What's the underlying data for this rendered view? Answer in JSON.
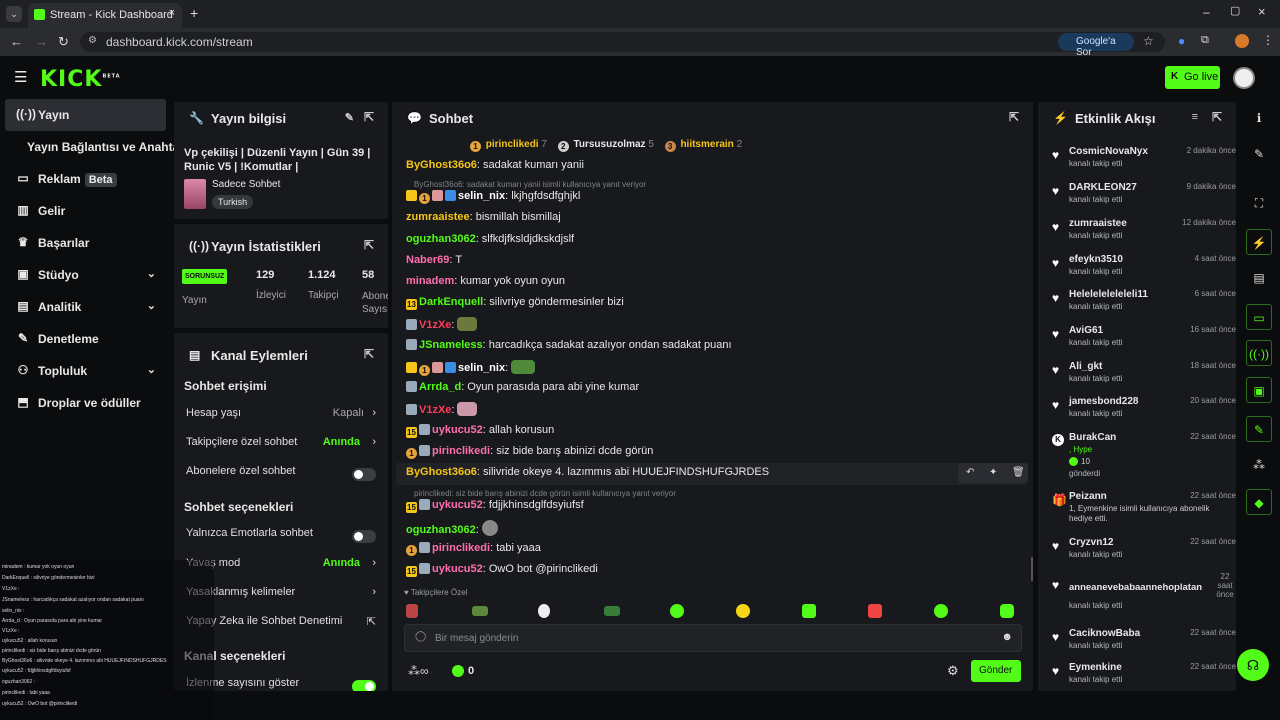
{
  "browser": {
    "tab_title": "Stream - Kick Dashboard",
    "url": "dashboard.kick.com/stream",
    "translate_label": "Google'a Sor"
  },
  "header": {
    "logo": "KICK",
    "logo_sup": "BETA",
    "go_live": "Go live"
  },
  "sidebar": {
    "items": [
      {
        "label": "Yayın",
        "icon": "broadcast-icon"
      },
      {
        "label": "Yayın Bağlantısı ve Anahtarı",
        "icon": ""
      },
      {
        "label": "Reklam",
        "icon": "ad-icon",
        "badge": "Beta"
      },
      {
        "label": "Gelir",
        "icon": "revenue-icon"
      },
      {
        "label": "Başarılar",
        "icon": "trophy-icon"
      },
      {
        "label": "Stüdyo",
        "icon": "studio-icon"
      },
      {
        "label": "Analitik",
        "icon": "chart-icon"
      },
      {
        "label": "Denetleme",
        "icon": "wrench-icon"
      },
      {
        "label": "Topluluk",
        "icon": "community-icon"
      },
      {
        "label": "Droplar ve ödüller",
        "icon": "drops-icon"
      }
    ]
  },
  "stream_info": {
    "title": "Yayın bilgisi",
    "stream_title": "Vp çekilişi | Düzenli Yayın | Gün 39 | Runic V5 | !Komutlar |",
    "category": "Sadece Sohbet",
    "language": "Turkish"
  },
  "stats": {
    "title": "Yayın İstatistikleri",
    "status": "SORUNSUZ",
    "status_label": "Yayın",
    "viewers": "129",
    "viewers_label": "İzleyici",
    "followers": "1.124",
    "followers_label": "Takipçi",
    "subs": "58",
    "subs_label": "Abone Sayısı"
  },
  "actions": {
    "title": "Kanal Eylemleri",
    "chat_access": "Sohbet erişimi",
    "account_age": "Hesap yaşı",
    "account_age_value": "Kapalı",
    "followers_only": "Takipçilere özel sohbet",
    "followers_only_value": "Anında",
    "subs_only": "Abonelere özel sohbet",
    "chat_options": "Sohbet seçenekleri",
    "emote_only": "Yalnızca Emotlarla sohbet",
    "slow_mode": "Yavaş mod",
    "slow_mode_value": "Anında",
    "banned_words": "Yasaklanmış kelimeler",
    "ai_moderation": "Yapay Zeka ile Sohbet Denetimi",
    "channel_options": "Kanal seçenekleri",
    "show_viewers": "İzlenme sayısını göster"
  },
  "chat": {
    "title": "Sohbet",
    "top": [
      {
        "rank": "1",
        "name": "pirinclikedi",
        "count": "7"
      },
      {
        "rank": "2",
        "name": "Tursusuzolmaz",
        "count": "5"
      },
      {
        "rank": "3",
        "name": "hiitsmerain",
        "count": "2"
      }
    ],
    "messages": [
      {
        "user": "ByGhost36o6",
        "text": ": sadakat kumarı yanii",
        "color": "#f5c518"
      },
      {
        "reply": "ByGhost36o6: sadakat kumarı yanii isimli kullanıcıya yanıt veriyor"
      },
      {
        "user": "selin_nix",
        "text": ": lkjhgfdsdfghjkl",
        "color": "#ffffff",
        "badges": true
      },
      {
        "user": "zumraaistee",
        "text": ": bismillah bismillaj",
        "color": "#f5c518"
      },
      {
        "user": "oguzhan3062",
        "text": ": slfkdjfksldjdkskdjslf",
        "color": "#53fc18"
      },
      {
        "user": "Naber69",
        "text": ": T",
        "color": "#ff6fb0"
      },
      {
        "user": "minadem",
        "text": ": kumar yok oyun oyun",
        "color": "#ff6fb0"
      },
      {
        "user": "DarkEnquell",
        "text": ": silivriye göndermesinler bizi",
        "color": "#53fc18"
      },
      {
        "user": "V1zXe",
        "text": ":",
        "color": "#ff3b5c"
      },
      {
        "user": "JSnameless",
        "text": ": harcadıkça sadakat azalıyor ondan sadakat puanı",
        "color": "#53fc18"
      },
      {
        "user": "selin_nix",
        "text": ":",
        "color": "#ffffff"
      },
      {
        "user": "Arrda_d",
        "text": ": Oyun parasıda para abi yine kumar",
        "color": "#53fc18"
      },
      {
        "user": "V1zXe",
        "text": ":",
        "color": "#ff3b5c"
      },
      {
        "user": "uykucu52",
        "text": ": allah korusun",
        "color": "#ff6fb0"
      },
      {
        "user": "pirinclikedi",
        "text": ": siz bide barış abinizi dcde görün",
        "color": "#ff6fb0"
      },
      {
        "user": "ByGhost36o6",
        "text": ": silivride okeye 4. lazımmıs abi HUUEJFINDSHUFGJRDES",
        "color": "#f5c518"
      },
      {
        "reply": "pirinclikedi: siz bide barış abinizi dcde görün isimli kullanıcıya yanıt veriyor"
      },
      {
        "user": "uykucu52",
        "text": ": fdjjkhinsdglfdsyiufsf",
        "color": "#ff6fb0"
      },
      {
        "user": "oguzhan3062",
        "text": ":",
        "color": "#53fc18"
      },
      {
        "user": "pirinclikedi",
        "text": ": tabi yaaa",
        "color": "#ff6fb0"
      },
      {
        "user": "uykucu52",
        "text": ": OwO bot @pirinclikedi",
        "color": "#ff6fb0"
      }
    ],
    "followers_only_tag": "Takipçilere Özel",
    "placeholder": "Bir mesaj gönderin",
    "points": "0",
    "send": "Gönder"
  },
  "activity": {
    "title": "Etkinlik Akışı",
    "events": [
      {
        "name": "CosmicNovaNyx",
        "time": "2 dakika önce",
        "sub": "kanalı takip etti"
      },
      {
        "name": "DARKLEON27",
        "time": "9 dakika önce",
        "sub": "kanalı takip etti"
      },
      {
        "name": "zumraaistee",
        "time": "12 dakika önce",
        "sub": "kanalı takip etti"
      },
      {
        "name": "efeykn3510",
        "time": "4 saat önce",
        "sub": "kanalı takip etti"
      },
      {
        "name": "Heleleleleleleli11",
        "time": "6 saat önce",
        "sub": "kanalı takip etti"
      },
      {
        "name": "AviG61",
        "time": "16 saat önce",
        "sub": "kanalı takip etti"
      },
      {
        "name": "Ali_gkt",
        "time": "18 saat önce",
        "sub": "kanalı takip etti"
      },
      {
        "name": "jamesbond228",
        "time": "20 saat önce",
        "sub": "kanalı takip etti"
      },
      {
        "name": "BurakCan",
        "time": "22 saat önce",
        "sub": ", Hype",
        "extra": "10",
        "extra2": "gönderdi"
      },
      {
        "name": "Peizann",
        "time": "22 saat önce",
        "sub": "1, Eymenkine isimli kullanıcıya abonelik hediye etti."
      },
      {
        "name": "Cryzvn12",
        "time": "22 saat önce",
        "sub": "kanalı takip etti"
      },
      {
        "name": "anneanevebabaannehoplatan",
        "time": "22 saat önce",
        "sub": "kanalı takip etti"
      },
      {
        "name": "CaciknowBaba",
        "time": "22 saat önce",
        "sub": "kanalı takip etti"
      },
      {
        "name": "Eymenkine",
        "time": "22 saat önce",
        "sub": "kanalı takip etti"
      }
    ]
  },
  "overlay": [
    "minadem : kumar yok oyun oyun",
    "DarkEnquell : silivriye göndermesinler bizi",
    "V1zXe :",
    "JSnameless : harcadıkça sadakat azalıyor ondan sadakat puanı",
    "selin_nix :",
    "Arrda_d : Oyun parasıda para abi yine kumar",
    "V1zXe :",
    "uykucu52 : allah korusun",
    "pirinclikedi : siz bide barış abinizi dcde görün",
    "ByGhost36o6 : silivride okeye 4. lazımmıs abi HUUEJFINDSHUFGJRDES",
    "uykucu52 : fdjjkhinsdglfdsyiufsf",
    "oguzhan3062 :",
    "pirinclikedi : tabi yaaa",
    "uykucu52 : OwO bot @pirinclikedi"
  ]
}
